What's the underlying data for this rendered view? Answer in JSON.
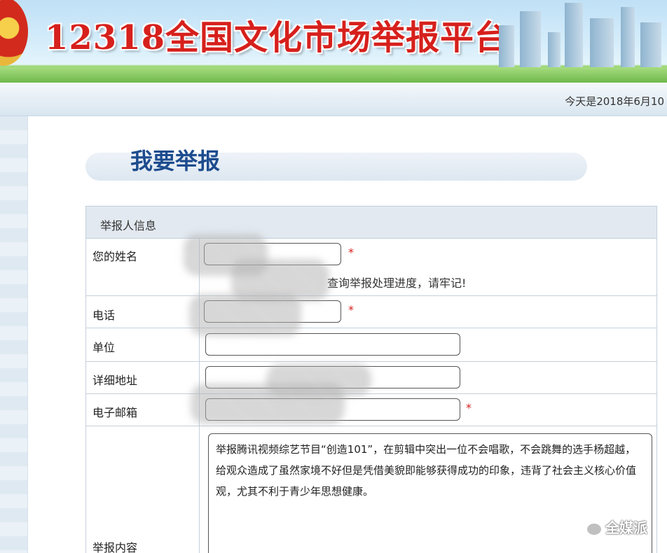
{
  "banner": {
    "title": "12318全国文化市场举报平台"
  },
  "datebar": {
    "date_text": "今天是2018年6月10"
  },
  "page": {
    "heading": "我要举报"
  },
  "form": {
    "section_title": "举报人信息",
    "name_label": "您的姓名",
    "name_note": "查询举报处理进度，请牢记!",
    "phone_label": "电话",
    "company_label": "单位",
    "address_label": "详细地址",
    "email_label": "电子邮箱",
    "content_label": "举报内容",
    "required_mark": "*",
    "content_text": "举报腾讯视频综艺节目“创造101”，在剪辑中突出一位不会唱歌，不会跳舞的选手杨超越，给观众造成了虽然家境不好但是凭借美貌即能够获得成功的印象，违背了社会主义核心价值观，尤其不利于青少年思想健康。"
  },
  "watermark": {
    "text": "全媒派"
  }
}
